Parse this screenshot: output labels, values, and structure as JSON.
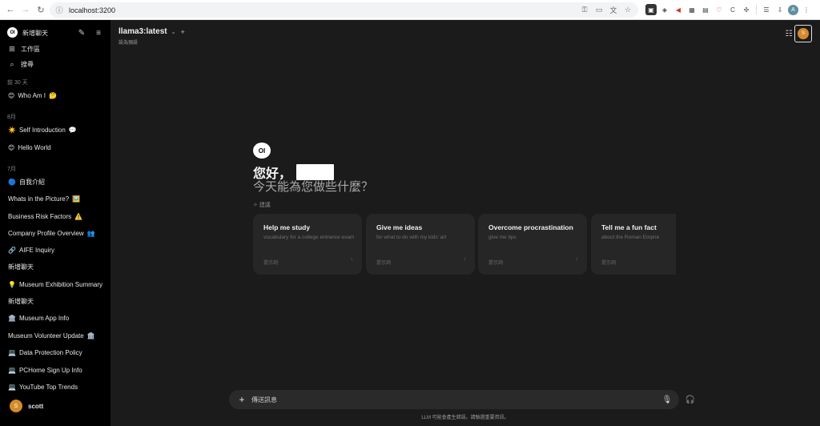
{
  "browser": {
    "url": "localhost:3200"
  },
  "sidebar": {
    "new_chat_label": "新增聊天",
    "workspace_label": "工作區",
    "search_label": "搜尋",
    "groups": [
      {
        "label": "前 30 天",
        "items": [
          {
            "pre": "😊",
            "label": "Who Am I",
            "post": "🤔"
          }
        ]
      },
      {
        "label": "8月",
        "items": [
          {
            "pre": "☀️",
            "label": "Self Introduction",
            "post": "💬"
          },
          {
            "pre": "😊",
            "label": "Hello World",
            "post": ""
          }
        ]
      },
      {
        "label": "7月",
        "items": [
          {
            "pre": "🔵",
            "label": "自我介紹",
            "post": ""
          },
          {
            "pre": "",
            "label": "Whats in the Picture?",
            "post": "🖼️"
          },
          {
            "pre": "",
            "label": "Business Risk Factors",
            "post": "⚠️"
          },
          {
            "pre": "",
            "label": "Company Profile Overview",
            "post": "👥"
          },
          {
            "pre": "🔗",
            "label": "AIFE Inquiry",
            "post": ""
          },
          {
            "pre": "",
            "label": "新增聊天",
            "post": ""
          },
          {
            "pre": "💡",
            "label": "Museum Exhibition Summary",
            "post": ""
          },
          {
            "pre": "",
            "label": "新增聊天",
            "post": ""
          },
          {
            "pre": "🏛️",
            "label": "Museum App Info",
            "post": ""
          },
          {
            "pre": "",
            "label": "Museum Volunteer Update",
            "post": "🏛️"
          },
          {
            "pre": "💻",
            "label": "Data Protection Policy",
            "post": ""
          },
          {
            "pre": "💻",
            "label": "PCHome Sign Up Info",
            "post": ""
          },
          {
            "pre": "💻",
            "label": "YouTube Top Trends",
            "post": ""
          }
        ]
      }
    ],
    "user": {
      "initial": "S",
      "name": "scott"
    }
  },
  "header": {
    "model": "llama3:latest",
    "set_default": "設為預設"
  },
  "hero": {
    "greeting": "您好，",
    "subtitle": "今天能為您做些什麼？",
    "suggest_label": "建議",
    "cards": [
      {
        "title": "Help me study",
        "subtitle": "vocabulary for a college entrance exam",
        "prompt": "提示詞"
      },
      {
        "title": "Give me ideas",
        "subtitle": "for what to do with my kids' art",
        "prompt": "提示詞"
      },
      {
        "title": "Overcome procrastination",
        "subtitle": "give me tips",
        "prompt": "提示詞"
      },
      {
        "title": "Tell me a fun fact",
        "subtitle": "about the Roman Empire",
        "prompt": "提示詞"
      }
    ]
  },
  "composer": {
    "placeholder": "傳送訊息",
    "disclaimer": "LLM 可能會產生錯誤。請驗證重要資訊。"
  },
  "colors": {
    "sidebar_bg": "#000000",
    "main_bg": "#1b1b1b",
    "card_bg": "#262626",
    "avatar": "#d58a2b"
  },
  "icons": {
    "back": "back-arrow-icon",
    "forward": "forward-arrow-icon",
    "reload": "reload-icon",
    "edit": "edit-icon",
    "menu": "menu-icon",
    "workspace": "grid-icon",
    "search": "search-icon",
    "controls": "sliders-icon",
    "mic": "microphone-icon",
    "headphones": "headphones-icon"
  }
}
